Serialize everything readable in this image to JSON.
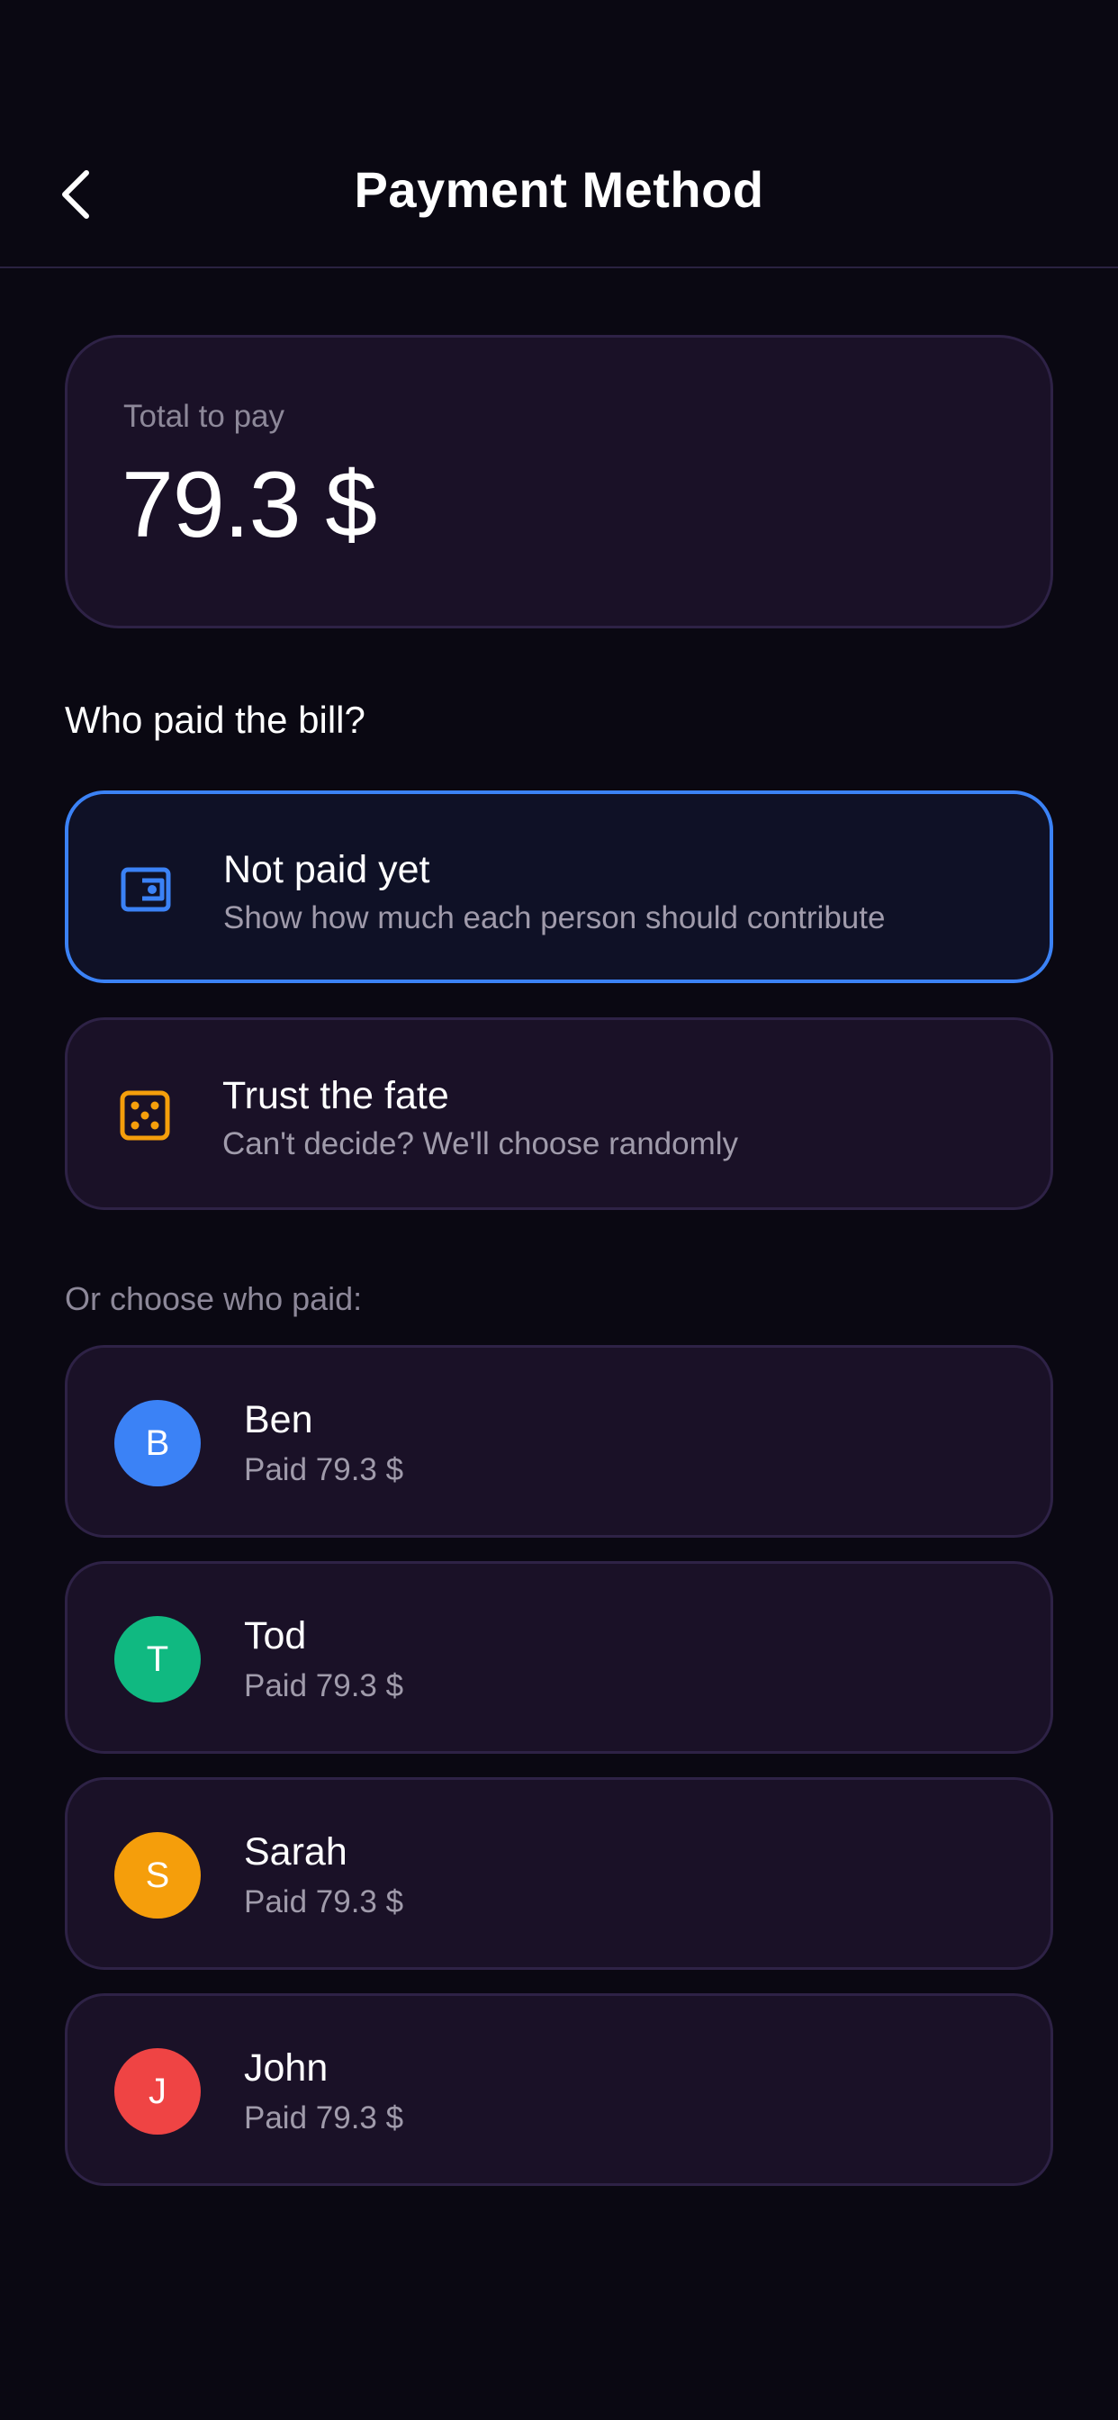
{
  "header": {
    "title": "Payment Method",
    "back_icon": "chevron-left-icon"
  },
  "total": {
    "label": "Total to pay",
    "amount": "79.3 $"
  },
  "question": "Who paid the bill?",
  "options": [
    {
      "title": "Not paid yet",
      "subtitle": "Show how much each person should contribute",
      "icon": "wallet-icon",
      "selected": true,
      "icon_color": "#3b82f6"
    },
    {
      "title": "Trust the fate",
      "subtitle": "Can't decide? We'll choose randomly",
      "icon": "dice-icon",
      "selected": false,
      "icon_color": "#f59e0b"
    }
  ],
  "choose_label": "Or choose who paid:",
  "people": [
    {
      "initial": "B",
      "name": "Ben",
      "paid": "Paid 79.3 $",
      "color": "#3b82f6"
    },
    {
      "initial": "T",
      "name": "Tod",
      "paid": "Paid 79.3 $",
      "color": "#10b981"
    },
    {
      "initial": "S",
      "name": "Sarah",
      "paid": "Paid 79.3 $",
      "color": "#f59e0b"
    },
    {
      "initial": "J",
      "name": "John",
      "paid": "Paid 79.3 $",
      "color": "#ef4444"
    }
  ],
  "colors": {
    "background": "#0a0812",
    "card": "#1a1127",
    "card_border": "#2e2246",
    "accent": "#3b82f6"
  }
}
